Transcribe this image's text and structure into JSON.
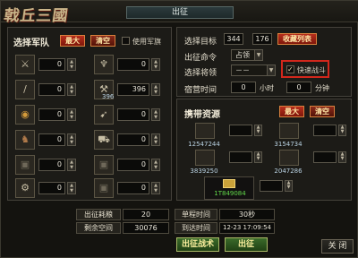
{
  "app": {
    "logo_text": "戟丘三國",
    "title": "出征"
  },
  "troops": {
    "header": "选择军队",
    "max_label": "最大",
    "clear_label": "清空",
    "use_flag_label": "使用军旗",
    "slots": [
      {
        "icon": "spear-icon",
        "glyph": "⚔",
        "value": "0",
        "count": ""
      },
      {
        "icon": "trident-icon",
        "glyph": "♆",
        "value": "0",
        "count": ""
      },
      {
        "icon": "lance-icon",
        "glyph": "/",
        "value": "0",
        "count": ""
      },
      {
        "icon": "halberd-icon",
        "glyph": "⚒",
        "value": "396",
        "count": "396"
      },
      {
        "icon": "shield-icon",
        "glyph": "◉",
        "value": "0",
        "count": ""
      },
      {
        "icon": "crossbow-icon",
        "glyph": "➹",
        "value": "0",
        "count": ""
      },
      {
        "icon": "horse-icon",
        "glyph": "♞",
        "value": "0",
        "count": ""
      },
      {
        "icon": "chariot-icon",
        "glyph": "⛟",
        "value": "0",
        "count": ""
      },
      {
        "icon": "locked-slot-icon",
        "glyph": "▣",
        "value": "0",
        "count": ""
      },
      {
        "icon": "locked-slot-icon",
        "glyph": "▣",
        "value": "0",
        "count": ""
      },
      {
        "icon": "catapult-icon",
        "glyph": "⚙",
        "value": "0",
        "count": ""
      },
      {
        "icon": "locked-slot-icon",
        "glyph": "▣",
        "value": "0",
        "count": ""
      }
    ]
  },
  "target": {
    "target_label": "选择目标",
    "x": "344",
    "y": "176",
    "favorites_label": "收藏列表",
    "command_label": "出征命令",
    "command_value": "占领",
    "general_label": "选择将领",
    "general_value": "－－",
    "fast_battle_label": "快速战斗",
    "camp_time_label": "宿营时间",
    "hours_value": "0",
    "hours_unit": "小时",
    "minutes_value": "0",
    "minutes_unit": "分钟"
  },
  "resources": {
    "header": "携带资源",
    "max_label": "最大",
    "clear_label": "清空",
    "items": [
      {
        "icon": "wood-icon",
        "value": "12547244"
      },
      {
        "icon": "stone-icon",
        "value": "3154734"
      },
      {
        "icon": "iron-icon",
        "value": "3839250"
      },
      {
        "icon": "food-icon",
        "value": "2047286"
      }
    ],
    "gold": {
      "icon": "gold-icon",
      "value": "1T849084"
    }
  },
  "summary": {
    "cost_label": "出征耗粮",
    "cost_value": "20",
    "space_label": "剩余空间",
    "space_value": "30076",
    "travel_label": "单程时间",
    "travel_value": "30秒",
    "arrive_label": "到达时间",
    "arrive_value": "12-23 17:09:54"
  },
  "actions": {
    "tactic_label": "出征战术",
    "confirm_label": "出征",
    "close_label": "关 闭"
  }
}
